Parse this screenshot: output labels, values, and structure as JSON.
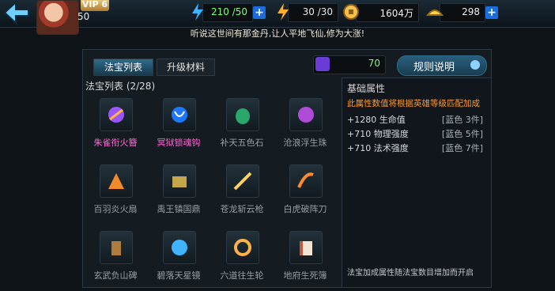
{
  "top": {
    "vip": "VIP 6",
    "level": "50",
    "stamina": "210 /50",
    "energy": "30 /30",
    "coins": "1604万",
    "ingots": "298",
    "ticker": "听说这世间有那金丹,让人平地飞仙,修为大涨!"
  },
  "tabs": [
    "法宝列表",
    "升级材料"
  ],
  "list_title": "法宝列表 (2/28)",
  "points": "70",
  "rules_label": "规则说明",
  "treasures": [
    {
      "name": "朱雀衔火簪",
      "color": "pink"
    },
    {
      "name": "冥狱锁魂钩",
      "color": "pink"
    },
    {
      "name": "补天五色石",
      "color": "gray"
    },
    {
      "name": "沧浪浮生珠",
      "color": "gray"
    },
    {
      "name": "百羽炎火扇",
      "color": "gray"
    },
    {
      "name": "禹王镇国鼎",
      "color": "gray"
    },
    {
      "name": "苍龙斩云枪",
      "color": "gray"
    },
    {
      "name": "白虎破阵刀",
      "color": "gray"
    },
    {
      "name": "玄武负山碑",
      "color": "gray"
    },
    {
      "name": "碧落天星镜",
      "color": "gray"
    },
    {
      "name": "六道往生轮",
      "color": "gray"
    },
    {
      "name": "地府生死簿",
      "color": "gray"
    }
  ],
  "attributes": {
    "title": "基础属性",
    "desc": "此属性数值将根据英雄等级匹配加成",
    "rows": [
      {
        "left": "+1280 生命值",
        "right": "[蓝色 3件]"
      },
      {
        "left": "+710 物理强度",
        "right": "[蓝色 5件]"
      },
      {
        "left": "+710 法术强度",
        "right": "[蓝色 7件]"
      }
    ],
    "footer": "法宝加成属性随法宝数目增加而开启"
  },
  "colors": {
    "accent": "#2f6b8c",
    "pink": "#ff6ad5",
    "gray": "#97a0a7",
    "plus": "#1b6ddd"
  }
}
